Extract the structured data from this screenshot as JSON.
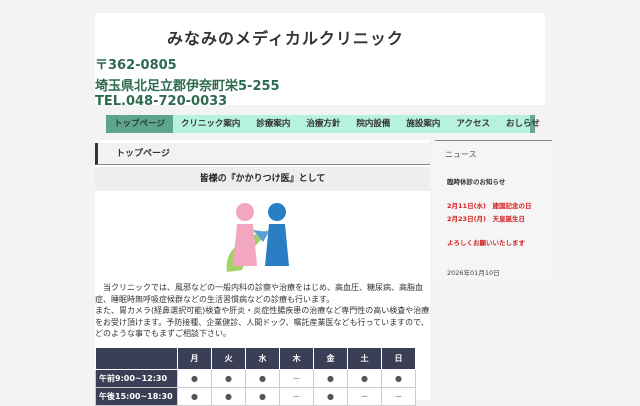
{
  "header": {
    "title": "みなみのメディカルクリニック",
    "postal": "〒362-0805",
    "address": "埼玉県北足立郡伊奈町栄5-255",
    "tel": "TEL.048-720-0033"
  },
  "nav": [
    "トップページ",
    "クリニック案内",
    "診療案内",
    "治療方針",
    "院内設備",
    "施設案内",
    "アクセス",
    "おしらせ"
  ],
  "main": {
    "page_title": "トップページ",
    "subtitle": "皆様の『かかりつけ医』として",
    "intro": "　当クリニックでは、風邪などの一般内科の診察や治療をはじめ、高血圧、糖尿病、高脂血症、睡眠時無呼吸症候群などの生活習慣病などの診療も行います。",
    "intro2": "また、胃カメラ(経鼻選択可能)検査や肝炎・炎症性腸疾患の治療など専門性の高い検査や治療をお受け頂けます。予防接種、企業健診、人間ドック、嘱託産業医なども行っていますので、どのような事でもまずご相談下さい。"
  },
  "schedule": {
    "days": [
      "月",
      "火",
      "水",
      "木",
      "金",
      "土",
      "日"
    ],
    "rows": [
      {
        "label": "午前9:00~12:30",
        "cells": [
          "●",
          "●",
          "●",
          "－",
          "●",
          "●",
          "●"
        ]
      },
      {
        "label": "午後15:00~18:30",
        "cells": [
          "●",
          "●",
          "●",
          "－",
          "●",
          "－",
          "－"
        ]
      }
    ]
  },
  "news": {
    "heading": "ニュース",
    "title": "臨時休診のお知らせ",
    "line1": "2月11日(水)　建国記念の日",
    "line2": "2月23日(月)　天皇誕生日",
    "line3": "よろしくお願いいたします",
    "date": "2026年01月10日"
  }
}
